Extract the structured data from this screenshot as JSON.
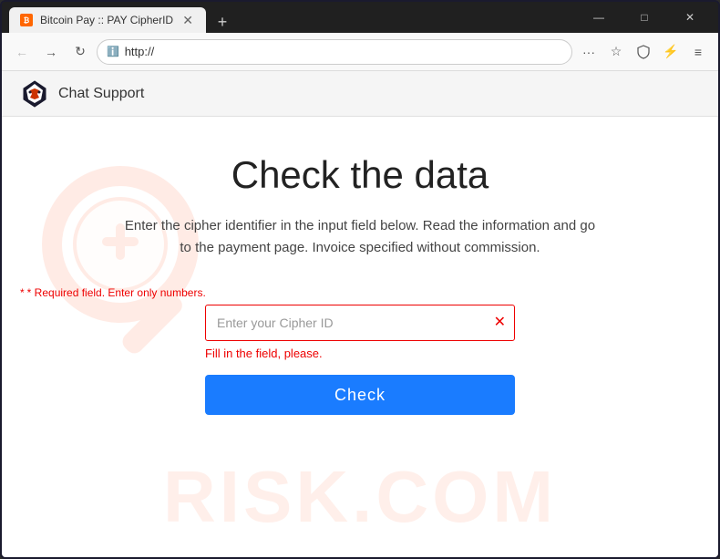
{
  "browser": {
    "tab_title": "Bitcoin Pay :: PAY CipherID",
    "tab_favicon": "₿",
    "url": "http://",
    "window_controls": {
      "minimize": "—",
      "maximize": "□",
      "close": "✕"
    },
    "new_tab_icon": "+",
    "nav": {
      "back": "←",
      "forward": "→",
      "refresh": "↻",
      "more": "···",
      "star": "☆",
      "shield": "🛡",
      "extension": "⚡",
      "menu": "≡"
    }
  },
  "header": {
    "logo_alt": "bitcoin-pay-logo",
    "nav_label": "Chat Support"
  },
  "main": {
    "title": "Check the data",
    "description": "Enter the cipher identifier in the input field below. Read the information and go to the payment page. Invoice specified without commission.",
    "required_text": "* Required field. Enter only numbers.",
    "input_placeholder": "Enter your Cipher ID",
    "input_value": "",
    "clear_icon": "✕",
    "error_text": "Fill in the field, please.",
    "check_button": "Check"
  },
  "watermark": {
    "text": "RISK.COM"
  }
}
